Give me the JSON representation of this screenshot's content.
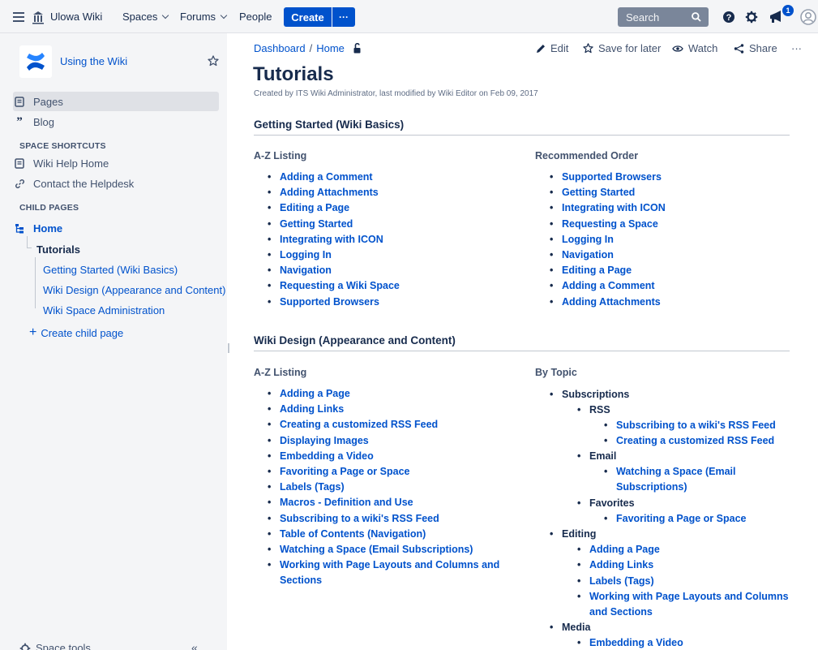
{
  "topbar": {
    "app_name": "Ulowa Wiki",
    "spaces": "Spaces",
    "forums": "Forums",
    "people": "People",
    "create": "Create",
    "more": "···",
    "search_placeholder": "Search",
    "notifications_count": "1"
  },
  "sidebar": {
    "space_name": "Using the Wiki",
    "pages": "Pages",
    "blog": "Blog",
    "shortcuts_label": "SPACE SHORTCUTS",
    "shortcut_help": "Wiki Help Home",
    "shortcut_contact": "Contact the Helpdesk",
    "child_pages_label": "CHILD PAGES",
    "tree": {
      "home": "Home",
      "tutorials": "Tutorials",
      "children": [
        "Getting Started (Wiki Basics)",
        "Wiki Design (Appearance and Content)",
        "Wiki Space Administration"
      ]
    },
    "create_child": "Create child page",
    "space_tools": "Space tools",
    "collapse": "«"
  },
  "breadcrumb": {
    "dashboard": "Dashboard",
    "sep": "/",
    "home": "Home"
  },
  "actions": {
    "edit": "Edit",
    "save": "Save for later",
    "watch": "Watch",
    "share": "Share",
    "more": "···"
  },
  "page": {
    "title": "Tutorials",
    "byline": "Created by ITS Wiki Administrator, last modified by Wiki Editor on Feb 09, 2017"
  },
  "section1": {
    "heading": "Getting Started (Wiki Basics)",
    "az_label": "A-Z Listing",
    "az_items": [
      "Adding a Comment",
      "Adding Attachments",
      "Editing a Page",
      "Getting Started",
      "Integrating with ICON",
      "Logging In",
      "Navigation",
      "Requesting a Wiki Space",
      "Supported Browsers"
    ],
    "rec_label": "Recommended Order",
    "rec_items": [
      "Supported Browsers",
      "Getting Started",
      "Integrating with ICON",
      "Requesting a Space",
      "Logging In",
      "Navigation",
      "Editing a Page",
      "Adding a Comment",
      "Adding Attachments"
    ]
  },
  "section2": {
    "heading": "Wiki Design (Appearance and Content)",
    "az_label": "A-Z Listing",
    "az_items": [
      "Adding a Page",
      "Adding Links",
      "Creating a customized RSS Feed",
      "Displaying Images",
      "Embedding a Video",
      "Favoriting a Page or Space",
      "Labels (Tags)",
      "Macros - Definition and Use",
      "Subscribing to a wiki's RSS Feed",
      "Table of Contents (Navigation)",
      "Watching a Space (Email Subscriptions)",
      "Working with Page Layouts and Columns and",
      "Sections"
    ],
    "topic_label": "By Topic",
    "topics": {
      "subscriptions": "Subscriptions",
      "rss": "RSS",
      "rss_sub": "Subscribing to a wiki's RSS Feed",
      "rss_custom": "Creating a customized RSS Feed",
      "email": "Email",
      "email_watch_1": "Watching a Space (Email",
      "email_watch_2": "Subscriptions)",
      "favorites": "Favorites",
      "fav_item": "Favoriting a Page or Space",
      "editing": "Editing",
      "edit_add_page": "Adding a Page",
      "edit_add_links": "Adding Links",
      "edit_labels": "Labels (Tags)",
      "edit_layouts_1": "Working with Page Layouts and Columns",
      "edit_layouts_2": "and Sections",
      "media": "Media",
      "media_video": "Embedding a Video"
    }
  },
  "colors": {
    "link": "#0052cc",
    "text": "#172b4d",
    "sidebar_bg": "#f4f5f7",
    "brand": "#0052cc"
  }
}
